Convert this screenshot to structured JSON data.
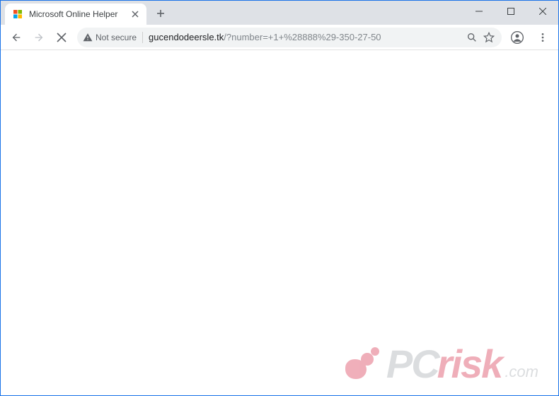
{
  "tab": {
    "title": "Microsoft Online Helper"
  },
  "security": {
    "label": "Not secure"
  },
  "url": {
    "host": "gucendodeersle.tk",
    "path": "/?number=+1+%28888%29-350-27-50"
  },
  "watermark": {
    "pc": "PC",
    "risk": "risk",
    "com": ".com"
  }
}
